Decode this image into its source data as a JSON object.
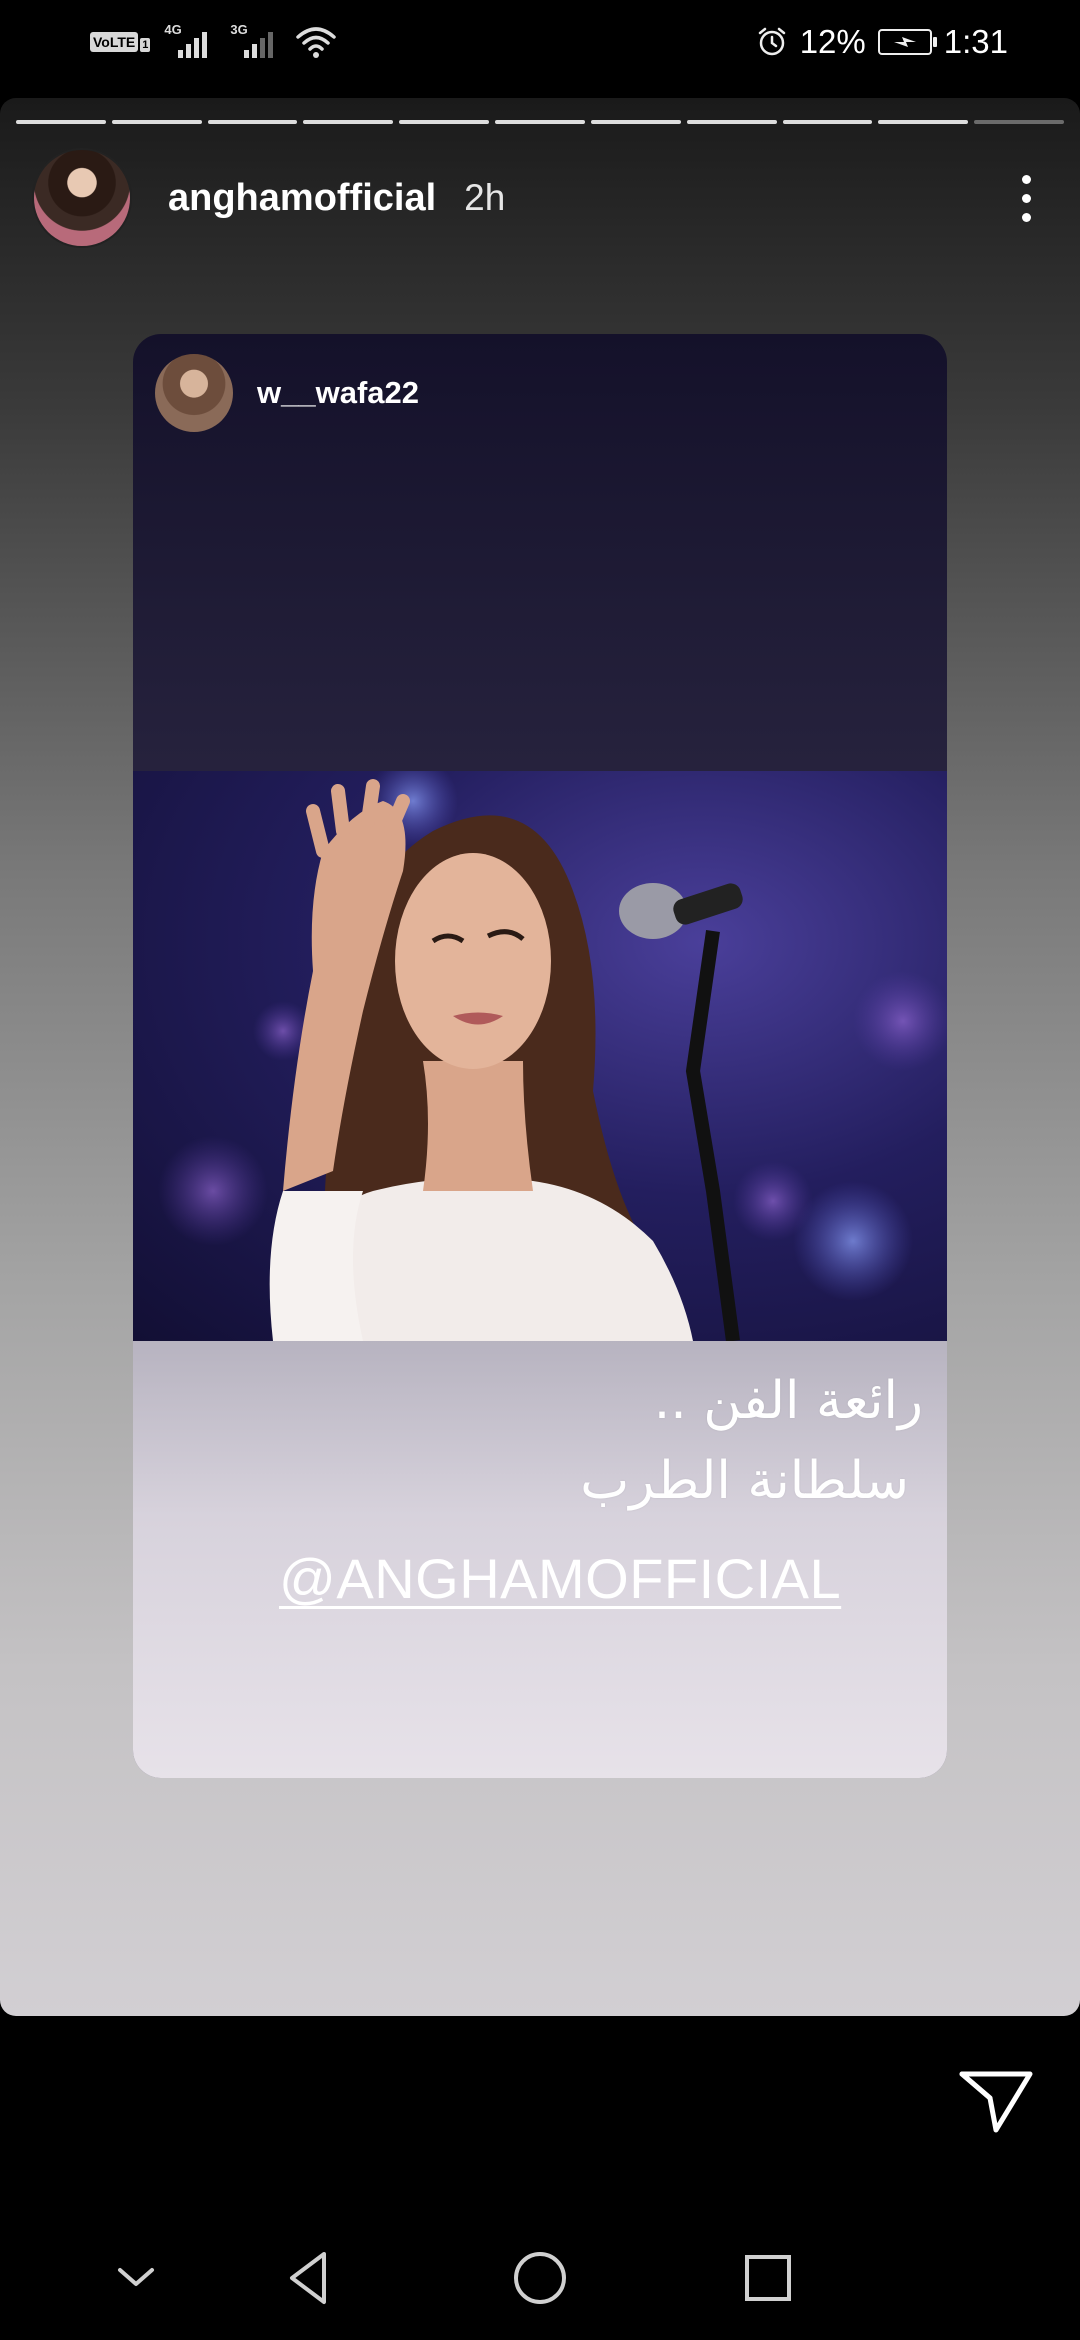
{
  "status_bar": {
    "volte": "VoLTE",
    "sim": "1",
    "network_1": "4G",
    "network_2": "3G",
    "battery_percent": "12%",
    "time": "1:31",
    "icons": [
      "alarm-icon",
      "battery-charging-icon",
      "wifi-icon",
      "signal-icon"
    ]
  },
  "story": {
    "progress": {
      "segments": 11,
      "viewed": 10
    },
    "username": "anghamofficial",
    "time_ago": "2h",
    "more_icon": "more-vertical-icon"
  },
  "shared_post": {
    "username": "w__wafa22",
    "caption_line_1": "رائعة الفن ..",
    "caption_line_2": "سلطانة الطرب",
    "mention": "@ANGHAMOFFICIAL"
  },
  "actions": {
    "send_icon": "send-icon"
  },
  "nav_bar": {
    "icons": [
      "collapse-icon",
      "back-icon",
      "home-icon",
      "recents-icon"
    ]
  }
}
